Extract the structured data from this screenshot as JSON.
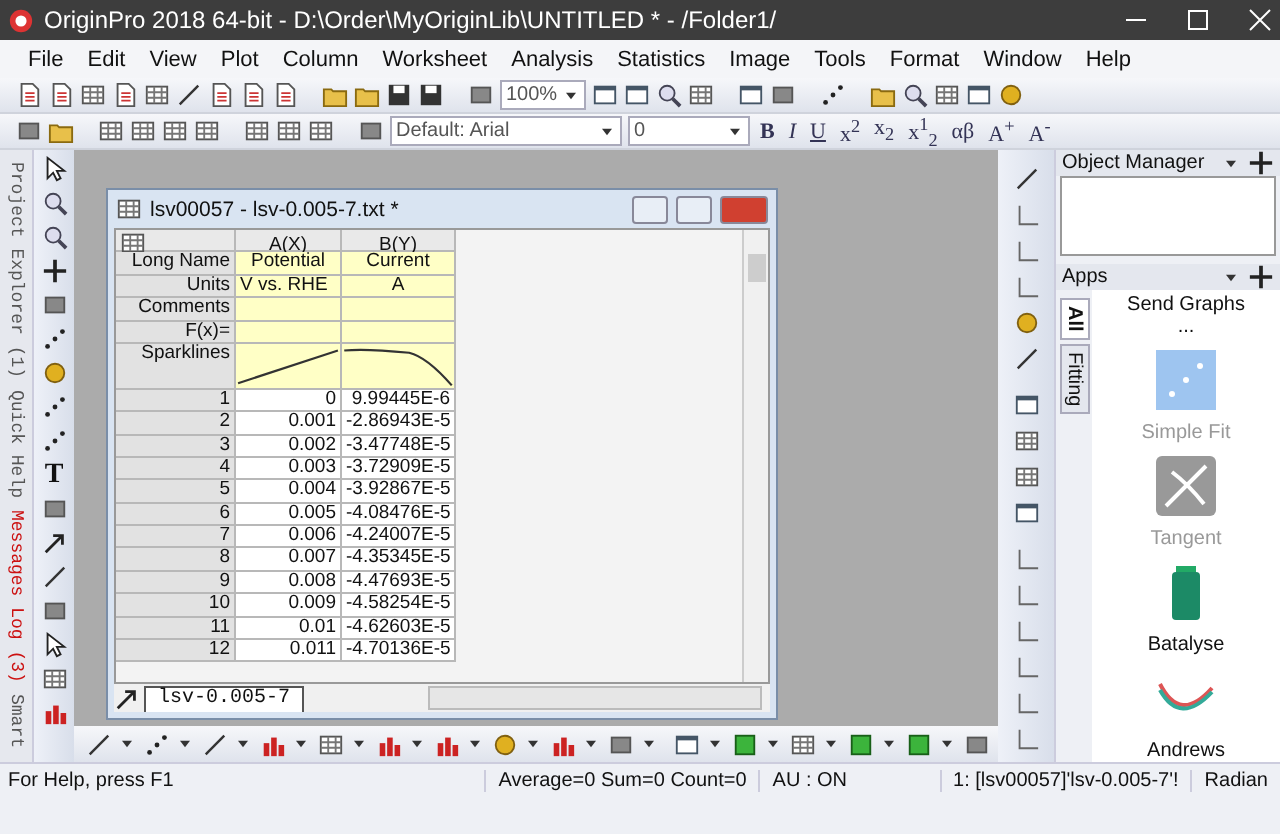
{
  "window": {
    "title": "OriginPro 2018 64-bit - D:\\Order\\MyOriginLib\\UNTITLED * - /Folder1/"
  },
  "menu": [
    "File",
    "Edit",
    "View",
    "Plot",
    "Column",
    "Worksheet",
    "Analysis",
    "Statistics",
    "Image",
    "Tools",
    "Format",
    "Window",
    "Help"
  ],
  "toolbar": {
    "zoom": "100%",
    "font": "Default: Arial",
    "font_size": "0",
    "format_buttons": [
      "B",
      "I",
      "U",
      "x$^{2}$",
      "x$_{2}$",
      "x$^{1}$$_{2}$",
      "αβ",
      "A$^{+}$",
      "A$^{-}$"
    ]
  },
  "left_tabs": [
    {
      "label": "Project Explorer (1)",
      "color": "#555555"
    },
    {
      "label": "Quick Help",
      "color": "#555555"
    },
    {
      "label": "Messages Log (3)",
      "color": "#cc1111"
    },
    {
      "label": "Smart",
      "color": "#555555"
    }
  ],
  "tools": {
    "text_tool": "T"
  },
  "worksheet": {
    "title": "lsv00057 - lsv-0.005-7.txt *",
    "columns": [
      {
        "name": "A(X)",
        "long_name": "Potential",
        "units": "V vs. RHE"
      },
      {
        "name": "B(Y)",
        "long_name": "Current",
        "units": "A"
      }
    ],
    "meta_labels": [
      "Long Name",
      "Units",
      "Comments",
      "F(x)=",
      "Sparklines"
    ],
    "rows": [
      {
        "n": "1",
        "a": "0",
        "b": "9.99445E-6"
      },
      {
        "n": "2",
        "a": "0.001",
        "b": "-2.86943E-5"
      },
      {
        "n": "3",
        "a": "0.002",
        "b": "-3.47748E-5"
      },
      {
        "n": "4",
        "a": "0.003",
        "b": "-3.72909E-5"
      },
      {
        "n": "5",
        "a": "0.004",
        "b": "-3.92867E-5"
      },
      {
        "n": "6",
        "a": "0.005",
        "b": "-4.08476E-5"
      },
      {
        "n": "7",
        "a": "0.006",
        "b": "-4.24007E-5"
      },
      {
        "n": "8",
        "a": "0.007",
        "b": "-4.35345E-5"
      },
      {
        "n": "9",
        "a": "0.008",
        "b": "-4.47693E-5"
      },
      {
        "n": "10",
        "a": "0.009",
        "b": "-4.58254E-5"
      },
      {
        "n": "11",
        "a": "0.01",
        "b": "-4.62603E-5"
      },
      {
        "n": "12",
        "a": "0.011",
        "b": "-4.70136E-5"
      }
    ],
    "sheet_tab": "lsv-0.005-7"
  },
  "object_manager": {
    "title": "Object Manager"
  },
  "apps": {
    "title": "Apps",
    "side_tabs": [
      {
        "label": "All",
        "selected": true
      },
      {
        "label": "Fitting",
        "selected": false
      }
    ],
    "items": [
      {
        "label": "Send Graphs ...",
        "kind": "text",
        "disabled": false
      },
      {
        "label": "Simple Fit",
        "kind": "fit",
        "disabled": true
      },
      {
        "label": "Tangent",
        "kind": "tangent",
        "disabled": true
      },
      {
        "label": "Batalyse",
        "kind": "battery",
        "disabled": false
      },
      {
        "label": "Andrews",
        "kind": "curve",
        "disabled": false
      }
    ]
  },
  "status_bar": {
    "help": "For Help, press F1",
    "stats": "Average=0 Sum=0 Count=0",
    "au": "AU : ON",
    "sheet": "1: [lsv00057]'lsv-0.005-7'!",
    "angle": "Radian"
  }
}
